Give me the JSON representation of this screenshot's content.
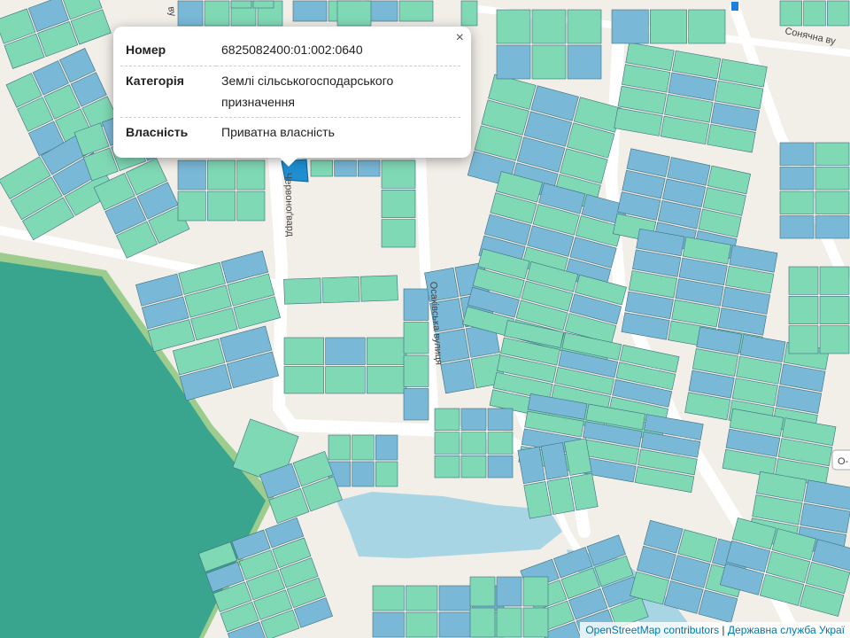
{
  "popup": {
    "close": "×",
    "rows": [
      {
        "label": "Номер",
        "value": "6825082400:01:002:0640"
      },
      {
        "label": "Категорія",
        "value": "Землі сільськогосподарського призначення"
      },
      {
        "label": "Власність",
        "value": "Приватна власність"
      }
    ]
  },
  "streets": {
    "chervonohvardiyska": "Червоноґвард",
    "osakivska": "Осаківська вулиця",
    "sonyachna": "Сонячна ву",
    "top_left": "ву",
    "edge_right": "О-"
  },
  "attribution": {
    "osm": "OpenStreetMap contributors",
    "separator": " | ",
    "service": "Державна служба Украї"
  },
  "colors": {
    "parcel_green": "#7fd9b5",
    "parcel_blue": "#7ab8d8",
    "forest": "#3aa58f",
    "water": "#a8d5e4",
    "road": "#ffffff",
    "background": "#f2efe9"
  }
}
